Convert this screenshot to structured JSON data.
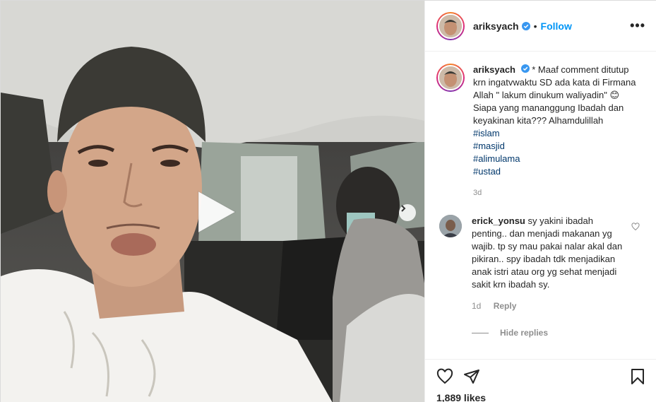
{
  "post": {
    "author": "ariksyach",
    "follow_label": "Follow",
    "separator": "•",
    "more_label": "•••",
    "caption": {
      "username": "ariksyach",
      "text_1": "* Maaf comment ditutup krn ingatvwaktu SD ada kata di Firmana Allah \" lakum dinukum waliyadin\"",
      "emoji": "😊",
      "text_2": "Siapa yang mananggung Ibadah dan keyakinan kita??? Alhamdulillah",
      "hashtags": [
        "#islam",
        "#masjid",
        "#alimulama",
        "#ustad"
      ],
      "time": "3d"
    },
    "comments": [
      {
        "username": "erick_yonsu",
        "text": "sy yakini ibadah penting.. dan menjadi makanan yg wajib. tp sy mau pakai nalar akal dan pikiran.. spy ibadah tdk menjadikan anak istri atau org yg sehat menjadi sakit krn ibadah sy.",
        "time": "1d",
        "reply_label": "Reply"
      }
    ],
    "hide_replies_label": "Hide replies",
    "likes": "1,889 likes"
  },
  "icons": {
    "verified": "verified-badge-icon",
    "play": "play-icon",
    "next": "chevron-right-icon",
    "like": "heart-icon",
    "share": "paper-plane-icon",
    "save": "bookmark-icon"
  },
  "colors": {
    "link": "#0095f6",
    "hashtag": "#00376b",
    "muted": "#8e8e8e",
    "text": "#262626"
  }
}
